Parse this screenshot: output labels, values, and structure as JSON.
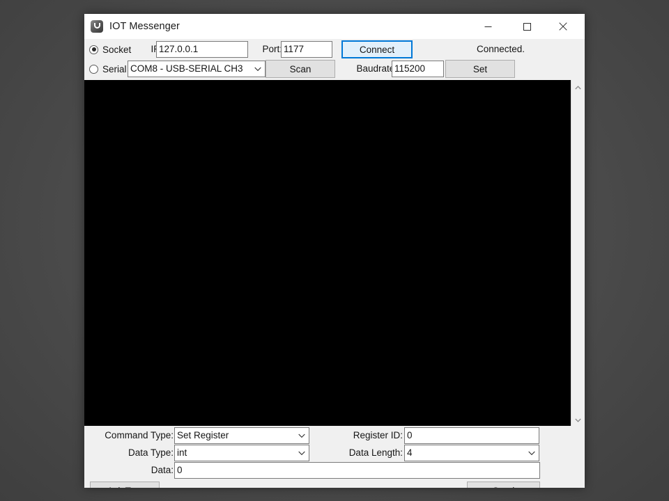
{
  "window": {
    "title": "IOT Messenger",
    "icon": "app-logo-u-icon",
    "controls": {
      "minimize": "minimize-icon",
      "maximize": "maximize-icon",
      "close": "close-icon"
    }
  },
  "connection": {
    "socket": {
      "radio_label": "Socket",
      "selected": true,
      "ip_label": "IP:",
      "ip_value": "127.0.0.1",
      "port_label": "Port:",
      "port_value": "1177"
    },
    "serial": {
      "radio_label": "Serial",
      "selected": false,
      "port_combo_value": "COM8 - USB-SERIAL CH3",
      "scan_label": "Scan",
      "baudrate_label": "Baudrate:",
      "baudrate_value": "115200",
      "set_label": "Set"
    },
    "connect_button": "Connect",
    "status": "Connected."
  },
  "console": {
    "text": "",
    "background_color": "#000000",
    "scrollbar": {
      "up_arrow": "chevron-up-icon",
      "down_arrow": "chevron-down-icon"
    }
  },
  "command": {
    "command_type_label": "Command Type:",
    "command_type_value": "Set Register",
    "data_type_label": "Data Type:",
    "data_type_value": "int",
    "data_label": "Data:",
    "data_value": "0",
    "register_id_label": "Register ID:",
    "register_id_value": "0",
    "data_length_label": "Data Length:",
    "data_length_value": "4"
  },
  "actions": {
    "ack_test_label": "Ack Test",
    "send_label": "Send"
  },
  "colors": {
    "accent": "#0078d7",
    "window_bg": "#f0f0f0",
    "console_bg": "#000000",
    "button_bg": "#e1e1e1"
  }
}
